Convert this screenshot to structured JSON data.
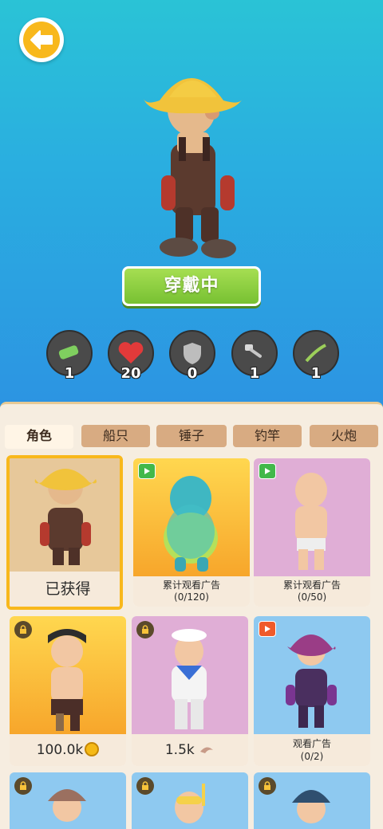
{
  "equip_label": "穿戴中",
  "stats": [
    "1",
    "20",
    "0",
    "1",
    "1"
  ],
  "tabs": [
    "角色",
    "船只",
    "锤子",
    "钓竿",
    "火炮"
  ],
  "cards": [
    {
      "foot": "已获得"
    },
    {
      "foot1": "累计观看广告",
      "foot2": "(0/120)"
    },
    {
      "foot1": "累计观看广告",
      "foot2": "(0/50)"
    },
    {
      "price": "100.0k"
    },
    {
      "price": "1.5k"
    },
    {
      "foot1": "观看广告",
      "foot2": "(0/2)"
    }
  ]
}
